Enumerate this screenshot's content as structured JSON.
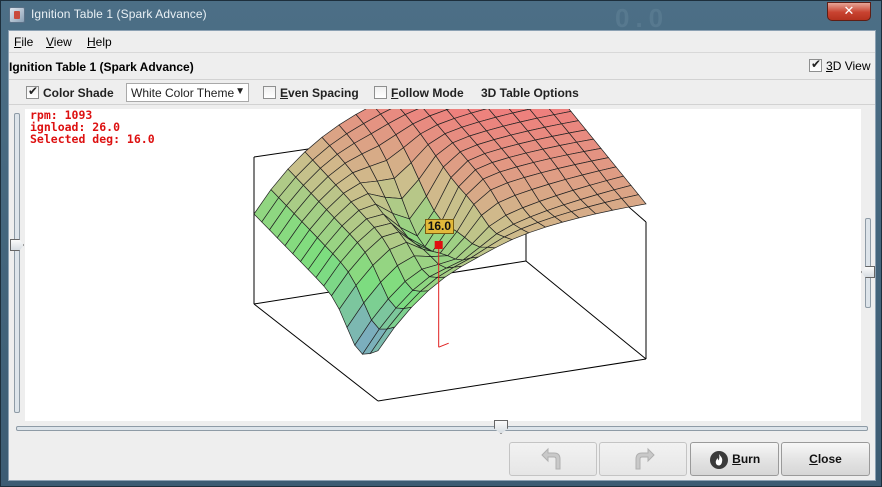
{
  "window": {
    "title": "Ignition Table 1 (Spark Advance)",
    "ghost_text": "0.0",
    "close_glyph": "✕"
  },
  "menu": {
    "items": [
      {
        "label": "File",
        "mnemonic": "F",
        "rest": "ile"
      },
      {
        "label": "View",
        "mnemonic": "V",
        "rest": "iew"
      },
      {
        "label": "Help",
        "mnemonic": "H",
        "rest": "elp"
      }
    ]
  },
  "panel": {
    "title": "Ignition Table 1 (Spark Advance)",
    "view3d_label_u": "3",
    "view3d_label_rest": "D View",
    "view3d_checked": true
  },
  "toolbar": {
    "color_shade_label": "Color Shade",
    "color_shade_checked": true,
    "theme_value": "White Color Theme",
    "even_spacing_u": "E",
    "even_spacing_rest": "ven Spacing",
    "even_spacing_checked": false,
    "follow_mode_u": "F",
    "follow_mode_rest": "ollow Mode",
    "follow_mode_checked": false,
    "options_label": "3D Table Options"
  },
  "readout": {
    "rpm": "rpm: 1093",
    "load": "ignload: 26.0",
    "selected": "Selected deg: 16.0",
    "cursor_label": "16.0"
  },
  "buttons": {
    "burn_u": "B",
    "burn_rest": "urn",
    "close_u": "C",
    "close_rest": "lose"
  },
  "colors": {
    "readout": "#dd1111",
    "low": "#7a90e6",
    "mid": "#7fe07a",
    "high": "#f07c7c"
  },
  "sliders": {
    "left_vertical": 0.5,
    "right_vertical": 0.5,
    "horizontal": 0.57
  }
}
